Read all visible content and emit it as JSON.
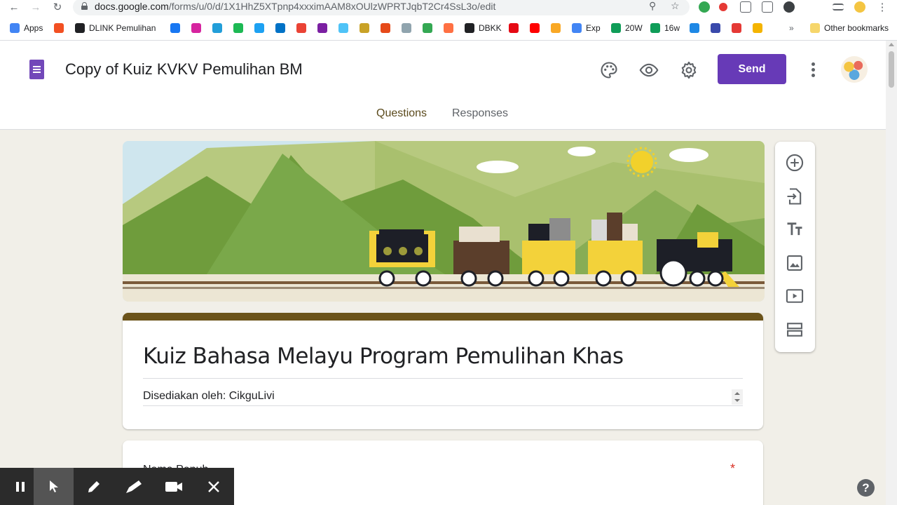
{
  "browser": {
    "url_prefix": "docs.google.com",
    "url_path": "/forms/u/0/d/1X1HhZ5XTpnp4xxximAAM8xOUlzWPRTJqbT2Cr4SsL3o/edit",
    "bookmarks": [
      {
        "label": "Apps",
        "icon": "apps-grid-icon",
        "color": "#4285f4"
      },
      {
        "label": "",
        "icon": "windows-icon",
        "color": "#f25022"
      },
      {
        "label": "DLINK Pemulihan",
        "icon": "globe-icon",
        "color": "#202124"
      },
      {
        "label": "",
        "icon": "facebook-icon",
        "color": "#1877f2"
      },
      {
        "label": "",
        "icon": "instagram-icon",
        "color": "#d6249f"
      },
      {
        "label": "",
        "icon": "telegram-icon",
        "color": "#229ed9"
      },
      {
        "label": "",
        "icon": "spotify-icon",
        "color": "#1db954"
      },
      {
        "label": "",
        "icon": "twitter-icon",
        "color": "#1da1f2"
      },
      {
        "label": "",
        "icon": "outlook-icon",
        "color": "#0072c6"
      },
      {
        "label": "",
        "icon": "gmail-icon",
        "color": "#ea4335"
      },
      {
        "label": "",
        "icon": "mail-icon",
        "color": "#7b1fa2"
      },
      {
        "label": "",
        "icon": "fish-icon",
        "color": "#4fc3f7"
      },
      {
        "label": "",
        "icon": "crest-icon",
        "color": "#c9a227"
      },
      {
        "label": "",
        "icon": "office-icon",
        "color": "#e64a19"
      },
      {
        "label": "",
        "icon": "doc-icon",
        "color": "#90a4ae"
      },
      {
        "label": "",
        "icon": "drive-icon",
        "color": "#34a853"
      },
      {
        "label": "",
        "icon": "bubble-icon",
        "color": "#ff7043"
      },
      {
        "label": "DBKK",
        "icon": "globe-icon",
        "color": "#202124"
      },
      {
        "label": "",
        "icon": "netflix-icon",
        "color": "#e50914"
      },
      {
        "label": "",
        "icon": "youtube-icon",
        "color": "#ff0000"
      },
      {
        "label": "",
        "icon": "runner-icon",
        "color": "#f9a825"
      },
      {
        "label": "Exp",
        "icon": "drive-icon",
        "color": "#4285f4"
      },
      {
        "label": "20W",
        "icon": "sheets-plus-icon",
        "color": "#0f9d58"
      },
      {
        "label": "16w",
        "icon": "sheets-plus-icon",
        "color": "#0f9d58"
      },
      {
        "label": "",
        "icon": "photo-icon",
        "color": "#1e88e5"
      },
      {
        "label": "",
        "icon": "r-icon",
        "color": "#3949ab"
      },
      {
        "label": "",
        "icon": "pdf-icon",
        "color": "#e53935"
      },
      {
        "label": "",
        "icon": "slides-icon",
        "color": "#f4b400"
      }
    ],
    "overflow": "»",
    "other_bookmarks": "Other bookmarks"
  },
  "form_header": {
    "doc_title": "Copy of Kuiz KVKV Pemulihan BM",
    "send_label": "Send",
    "tabs": [
      "Questions",
      "Responses"
    ],
    "active_tab": "Questions"
  },
  "form": {
    "title": "Kuiz Bahasa Melayu Program Pemulihan Khas",
    "description": "Disediakan oleh: CikguLivi",
    "first_question_label": "Nama Penuh",
    "required_marker": "*"
  },
  "side_toolbar": [
    "add-question-icon",
    "import-questions-icon",
    "add-title-icon",
    "add-image-icon",
    "add-video-icon",
    "add-section-icon"
  ],
  "recorder": [
    "pause-icon",
    "pointer-icon",
    "pen-icon",
    "highlighter-icon",
    "camera-icon",
    "close-icon"
  ],
  "help_label": "?",
  "colors": {
    "accent": "#673ab7",
    "theme_bar": "#6b531a",
    "background": "#f1efe8"
  }
}
